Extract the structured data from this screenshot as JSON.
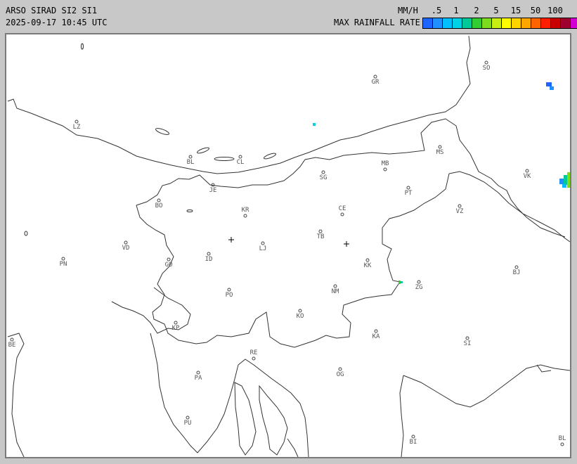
{
  "header": {
    "title": "ARSO SIRAD SI2 SI1",
    "timestamp": "2025-09-17 10:45 UTC",
    "unit": "MM/H",
    "rate_label": "MAX RAINFALL RATE"
  },
  "legend": {
    "ticks": [
      ".5",
      "1",
      "2",
      "5",
      "15",
      "50",
      "100"
    ],
    "colors": [
      "#1e64ff",
      "#1e90ff",
      "#00bfff",
      "#00d2e6",
      "#00c896",
      "#32cd32",
      "#7cdc1e",
      "#c8ef14",
      "#ffff00",
      "#ffd200",
      "#ffa500",
      "#ff6400",
      "#ff1e00",
      "#c80000",
      "#a0002d",
      "#d200d2"
    ]
  },
  "map": {
    "cities": [
      {
        "code": "SO"
      },
      {
        "code": "GR"
      },
      {
        "code": "LZ"
      },
      {
        "code": "BL"
      },
      {
        "code": "CL"
      },
      {
        "code": "MS"
      },
      {
        "code": "MB"
      },
      {
        "code": "VK"
      },
      {
        "code": "SG"
      },
      {
        "code": "JE"
      },
      {
        "code": "PT"
      },
      {
        "code": "BO"
      },
      {
        "code": "KR"
      },
      {
        "code": "CE"
      },
      {
        "code": "VZ"
      },
      {
        "code": "TB"
      },
      {
        "code": "VD"
      },
      {
        "code": "LJ"
      },
      {
        "code": "PN"
      },
      {
        "code": "GO"
      },
      {
        "code": "ID"
      },
      {
        "code": "KK"
      },
      {
        "code": "BJ"
      },
      {
        "code": "ZG"
      },
      {
        "code": "NM"
      },
      {
        "code": "PO"
      },
      {
        "code": "KO"
      },
      {
        "code": "KP"
      },
      {
        "code": "KA"
      },
      {
        "code": "SI"
      },
      {
        "code": "BE"
      },
      {
        "code": "RE"
      },
      {
        "code": "PA"
      },
      {
        "code": "OG"
      },
      {
        "code": "PU"
      },
      {
        "code": "BI"
      },
      {
        "code": "BL"
      }
    ]
  }
}
